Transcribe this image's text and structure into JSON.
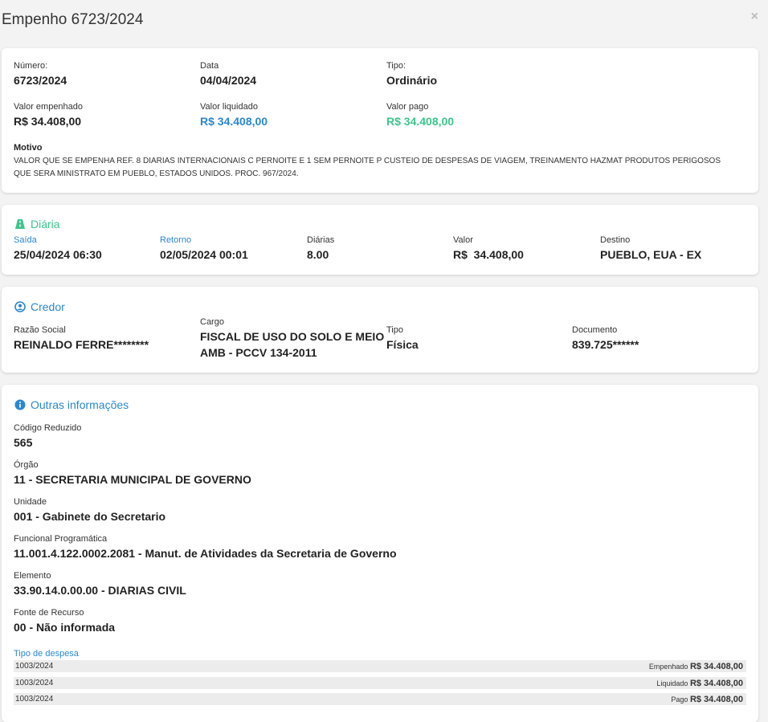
{
  "modal": {
    "title": "Empenho 6723/2024",
    "close_glyph": "×"
  },
  "empenho": {
    "numero_label": "Número:",
    "numero": "6723/2024",
    "data_label": "Data",
    "data": "04/04/2024",
    "tipo_label": "Tipo:",
    "tipo": "Ordinário",
    "valor_empenhado_label": "Valor empenhado",
    "valor_empenhado": "R$ 34.408,00",
    "valor_liquidado_label": "Valor liquidado",
    "valor_liquidado": "R$ 34.408,00",
    "valor_pago_label": "Valor pago",
    "valor_pago": "R$ 34.408,00",
    "motivo_label": "Motivo",
    "motivo_line1": "VALOR QUE SE EMPENHA REF. 8 DIARIAS INTERNACIONAIS C PERNOITE E 1 SEM PERNOITE P CUSTEIO DE DESPESAS DE VIAGEM, TREINAMENTO HAZMAT PRODUTOS PERIGOSOS",
    "motivo_line2": "QUE SERA MINISTRATO EM PUEBLO, ESTADOS UNIDOS. PROC. 967/2024."
  },
  "diaria": {
    "title": "Diária",
    "icon": "road-icon",
    "saida_label": "Saída",
    "saida": "25/04/2024 06:30",
    "retorno_label": "Retorno",
    "retorno": "02/05/2024 00:01",
    "diarias_label": "Diárias",
    "diarias": "8.00",
    "valor_label": "Valor",
    "valor": "R$  34.408,00",
    "destino_label": "Destino",
    "destino": "PUEBLO, EUA - EX"
  },
  "credor": {
    "title": "Credor",
    "icon": "user-circle-icon",
    "razao_label": "Razão Social",
    "razao": "REINALDO FERRE********",
    "cargo_label": "Cargo",
    "cargo_line1": "FISCAL DE USO DO SOLO E MEIO",
    "cargo_line2": "AMB - PCCV 134-2011",
    "tipo_label": "Tipo",
    "tipo": "Física",
    "documento_label": "Documento",
    "documento": "839.725******"
  },
  "outras": {
    "title": "Outras informações",
    "icon": "info-circle-icon",
    "codigo_label": "Código Reduzido",
    "codigo": "565",
    "orgao_label": "Órgão",
    "orgao": "11 - SECRETARIA MUNICIPAL DE GOVERNO",
    "unidade_label": "Unidade",
    "unidade": "001 - Gabinete do Secretario",
    "funcional_label": "Funcional Programática",
    "funcional": "11.001.4.122.0002.2081 - Manut. de Atividades da Secretaria de Governo",
    "elemento_label": "Elemento",
    "elemento": "33.90.14.0.00.00 - DIARIAS CIVIL",
    "fonte_label": "Fonte de Recurso",
    "fonte": "00 - Não informada",
    "tipo_despesa_label": "Tipo de despesa",
    "despesas": [
      {
        "ref": "1003/2024",
        "kind": "Empenhado",
        "value": "R$ 34.408,00"
      },
      {
        "ref": "1003/2024",
        "kind": "Liquidado",
        "value": "R$ 34.408,00"
      },
      {
        "ref": "1003/2024",
        "kind": "Pago",
        "value": "R$ 34.408,00"
      }
    ]
  },
  "colors": {
    "blue": "#2a87d0",
    "green": "#3cc58c"
  }
}
